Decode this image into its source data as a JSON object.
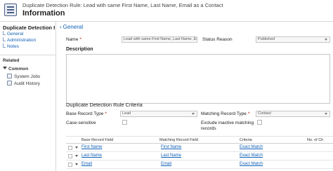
{
  "header": {
    "breadcrumb": "Duplicate Detection Rule: Lead with same First Name, Last Name, Email as a Contact",
    "title": "Information"
  },
  "leftnav": {
    "entity_title": "Duplicate Detection Rule :...",
    "links": [
      "General",
      "Administration",
      "Notes"
    ],
    "related_label": "Related",
    "common_label": "Common",
    "common_items": [
      "System Jobs",
      "Audit History"
    ]
  },
  "general": {
    "section_label": "General",
    "name_label": "Name",
    "name_value": "Lead with same First Name, Last Name, Email",
    "status_reason_label": "Status Reason",
    "status_reason_value": "Published",
    "description_label": "Description"
  },
  "criteria": {
    "title": "Duplicate Detection Rule Criteria",
    "base_record_type_label": "Base Record Type",
    "base_record_type_value": "Lead",
    "matching_record_type_label": "Matching Record Type",
    "matching_record_type_value": "Contact",
    "case_sensitive_label": "Case-sensitive",
    "exclude_inactive_label_line1": "Exclude inactive matching",
    "exclude_inactive_label_line2": "records"
  },
  "grid": {
    "columns": [
      "Base Record Field",
      "Matching Record Field",
      "Criteria",
      "No. of Ch"
    ],
    "rows": [
      {
        "base": "First Name",
        "matching": "First Name",
        "criteria": "Exact Match"
      },
      {
        "base": "Last Name",
        "matching": "Last Name",
        "criteria": "Exact Match"
      },
      {
        "base": "Email",
        "matching": "Email",
        "criteria": "Exact Match"
      }
    ]
  },
  "colors": {
    "link": "#1160b7",
    "required": "#c00000",
    "border": "#d8d8d8"
  }
}
